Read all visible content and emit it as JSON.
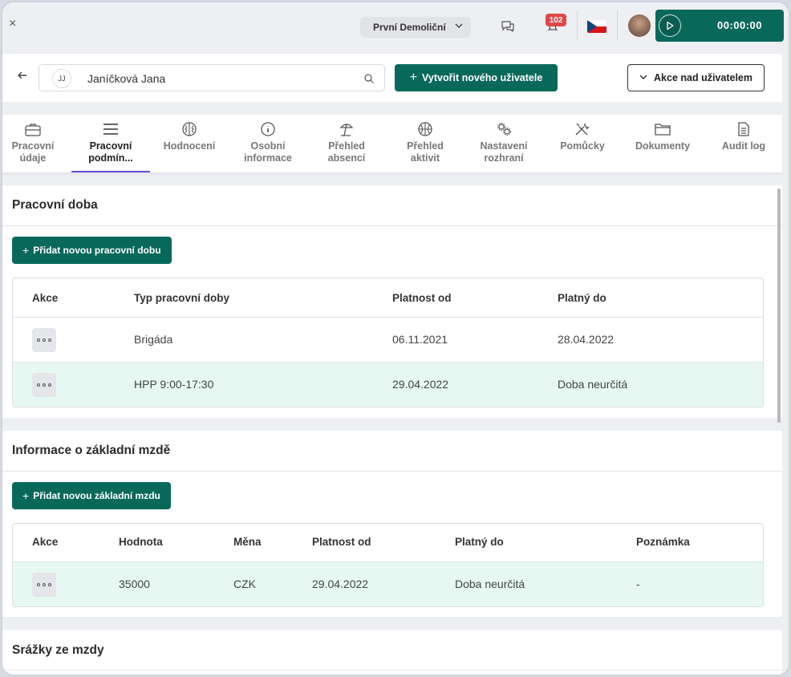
{
  "topbar": {
    "close": "×",
    "company": "První Demoliční",
    "notifications_count": "102",
    "timer": "00:00:00"
  },
  "userbar": {
    "user_initials": "JJ",
    "user_name": "Janíčková Jana",
    "create_user_label": "Vytvořit nového uživatele",
    "user_actions_label": "Akce nad uživatelem"
  },
  "tabs": [
    {
      "l1": "Pracovní",
      "l2": "údaje",
      "icon": "briefcase-icon"
    },
    {
      "l1": "Pracovní",
      "l2": "podmín...",
      "icon": "menu-icon",
      "active": true
    },
    {
      "l1": "Hodnocení",
      "l2": "",
      "icon": "brain-icon"
    },
    {
      "l1": "Osobní",
      "l2": "informace",
      "icon": "info-icon"
    },
    {
      "l1": "Přehled",
      "l2": "absencí",
      "icon": "beach-umbrella-icon"
    },
    {
      "l1": "Přehled",
      "l2": "aktivit",
      "icon": "basketball-icon"
    },
    {
      "l1": "Nastavení",
      "l2": "rozhraní",
      "icon": "gears-icon"
    },
    {
      "l1": "Pomůcky",
      "l2": "",
      "icon": "tools-icon"
    },
    {
      "l1": "Dokumenty",
      "l2": "",
      "icon": "folder-icon"
    },
    {
      "l1": "Audit log",
      "l2": "",
      "icon": "document-icon"
    }
  ],
  "work_time": {
    "title": "Pracovní doba",
    "add_label": "Přidat novou pracovní dobu",
    "headers": [
      "Akce",
      "Typ pracovní doby",
      "Platnost od",
      "Platný do"
    ],
    "rows": [
      {
        "type": "Brigáda",
        "from": "06.11.2021",
        "to": "28.04.2022",
        "highlight": false
      },
      {
        "type": "HPP 9:00-17:30",
        "from": "29.04.2022",
        "to": "Doba neurčitá",
        "highlight": true
      }
    ]
  },
  "salary": {
    "title": "Informace o základní mzdě",
    "add_label": "Přidat novou základní mzdu",
    "headers": [
      "Akce",
      "Hodnota",
      "Měna",
      "Platnost od",
      "Platný do",
      "Poznámka"
    ],
    "rows": [
      {
        "value": "35000",
        "currency": "CZK",
        "from": "29.04.2022",
        "to": "Doba neurčitá",
        "note": "-",
        "highlight": true
      }
    ]
  },
  "deductions": {
    "title": "Srážky ze mzdy"
  },
  "colors": {
    "primary": "#08695b",
    "highlight_row": "#e6f8f1",
    "tab_underline": "#6a4be0",
    "badge": "#e04848"
  }
}
